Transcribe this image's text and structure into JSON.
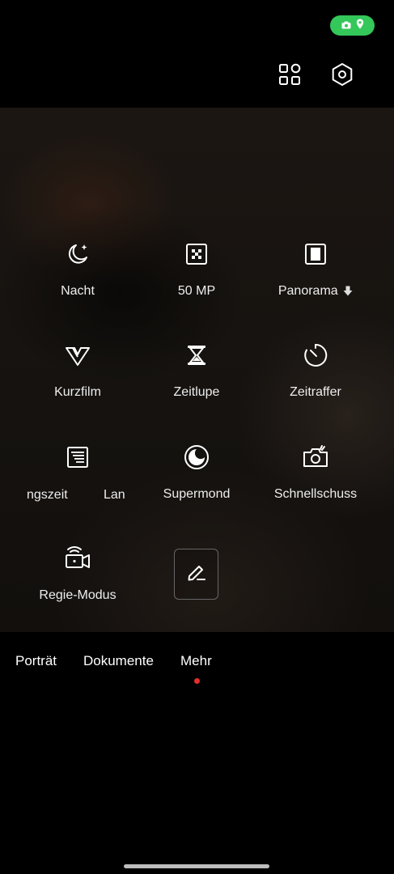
{
  "status": {
    "icons": [
      "camera-icon",
      "location-pin-icon"
    ],
    "pill_color": "#34c759"
  },
  "topbar": {
    "icons": [
      "grid-icon",
      "settings-hexagon-icon"
    ]
  },
  "modes": [
    {
      "label": "Nacht",
      "icon": "moon-stars-icon"
    },
    {
      "label": "50 MP",
      "icon": "dot-matrix-icon"
    },
    {
      "label": "Panorama",
      "icon": "panorama-icon",
      "badge": "download-arrow-icon"
    },
    {
      "label": "Kurzfilm",
      "icon": "v-logo-icon"
    },
    {
      "label": "Zeitlupe",
      "icon": "hourglass-icon"
    },
    {
      "label": "Zeitraffer",
      "icon": "timer-icon"
    },
    {
      "label": "ngszeit",
      "icon": "long-exposure-icon",
      "extra_label": "Lan"
    },
    {
      "label": "Supermond",
      "icon": "supermoon-icon"
    },
    {
      "label": "Schnellschuss",
      "icon": "quick-shot-camera-icon"
    },
    {
      "label": "Regie-Modus",
      "icon": "director-camera-icon"
    }
  ],
  "edit_button": {
    "icon": "pencil-edit-icon"
  },
  "bottom_tabs": [
    {
      "label": "Porträt"
    },
    {
      "label": "Dokumente"
    },
    {
      "label": "Mehr",
      "active": true
    }
  ],
  "colors": {
    "accent_dot": "#e0302b",
    "status_pill": "#34c759"
  }
}
